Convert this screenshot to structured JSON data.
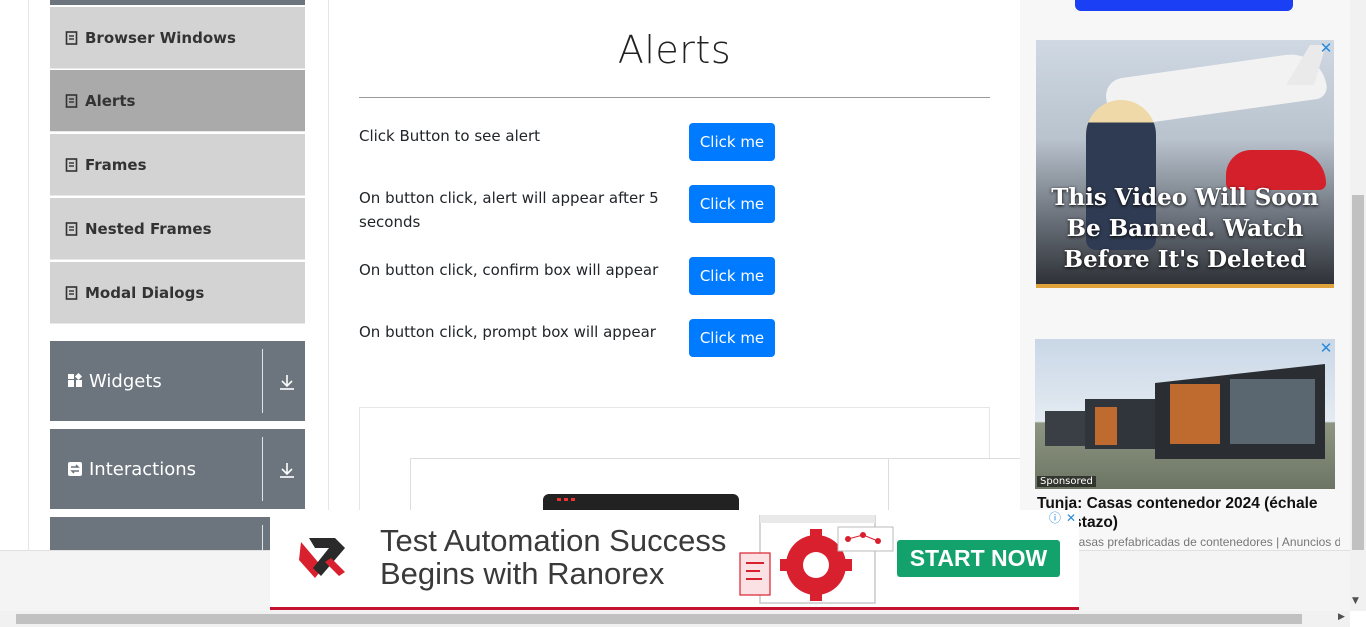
{
  "sidebar": {
    "items": [
      {
        "label": "Browser Windows",
        "icon": "document-icon",
        "active": false
      },
      {
        "label": "Alerts",
        "icon": "document-icon",
        "active": true
      },
      {
        "label": "Frames",
        "icon": "document-icon",
        "active": false
      },
      {
        "label": "Nested Frames",
        "icon": "document-icon",
        "active": false
      },
      {
        "label": "Modal Dialogs",
        "icon": "document-icon",
        "active": false
      }
    ],
    "groups": [
      {
        "label": "Widgets",
        "icon": "grid-icon",
        "toggle_icon": "download-arrow-icon"
      },
      {
        "label": "Interactions",
        "icon": "swap-icon",
        "toggle_icon": "download-arrow-icon"
      }
    ]
  },
  "main": {
    "title": "Alerts",
    "rows": [
      {
        "text": "Click Button to see alert",
        "button": "Click me"
      },
      {
        "text": "On button click, alert will appear after 5 seconds",
        "button": "Click me"
      },
      {
        "text": "On button click, confirm box will appear",
        "button": "Click me"
      },
      {
        "text": "On button click, prompt box will appear",
        "button": "Click me"
      }
    ]
  },
  "right_ads": {
    "video_caption": "This Video Will Soon Be Banned. Watch Before It's Deleted",
    "close_glyph": "✕",
    "sponsored_label": "Sponsored",
    "headline": "Tunja: Casas contenedor 2024 (échale un vistazo)",
    "source": "Casas prefabricadas de contenedores | Anuncios de b..."
  },
  "bottom_banner": {
    "line1": "Test Automation Success",
    "line2": "Begins with Ranorex",
    "cta": "START NOW",
    "info_glyph": "ⓘ",
    "close_glyph": "✕",
    "accent_color": "#c4122f",
    "cta_color": "#13a26c"
  },
  "colors": {
    "button": "#007bff",
    "sidebar_item": "#d3d3d3",
    "sidebar_active": "#aaaaaa",
    "group": "#6c757d"
  }
}
